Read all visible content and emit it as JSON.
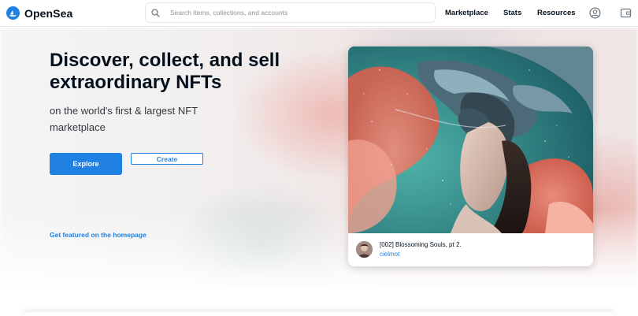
{
  "header": {
    "logo_text": "OpenSea",
    "search_placeholder": "Search items, collections, and accounts",
    "nav": [
      "Marketplace",
      "Stats",
      "Resources"
    ]
  },
  "hero": {
    "headline": "Discover, collect, and sell extraordinary NFTs",
    "subline": "on the world's first & largest NFT marketplace",
    "explore_label": "Explore",
    "create_label": "Create",
    "featured_link": "Get featured on the homepage"
  },
  "card": {
    "title": "[002] Blossoming Souls, pt 2.",
    "creator": "cielmot"
  },
  "colors": {
    "accent": "#2081e2",
    "text": "#04111d"
  }
}
